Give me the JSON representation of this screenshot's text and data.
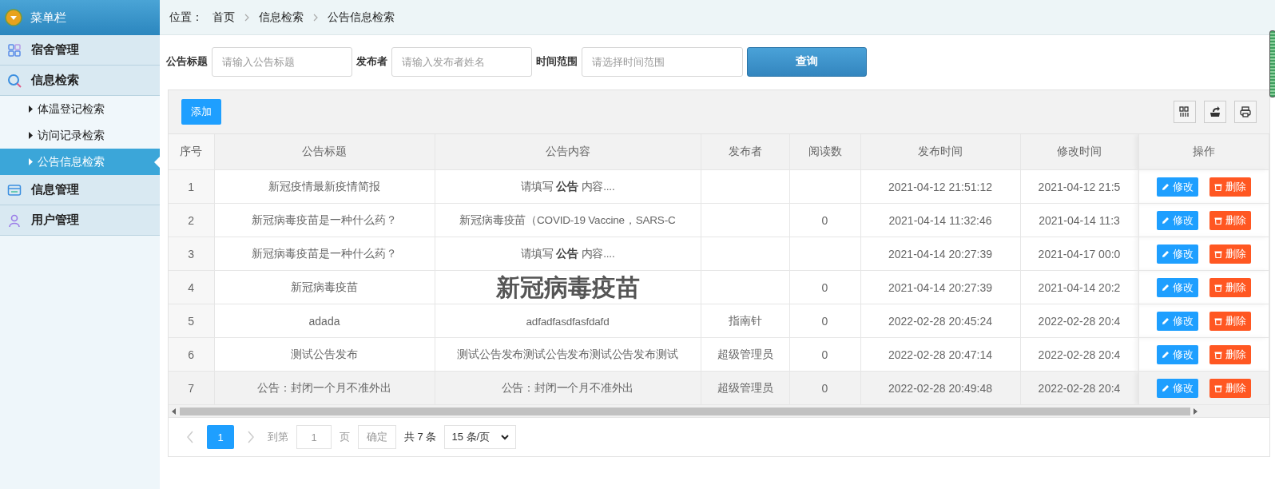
{
  "sidebar": {
    "title": "菜单栏",
    "items": [
      {
        "label": "宿舍管理"
      },
      {
        "label": "信息检索",
        "children": [
          {
            "label": "体温登记检索",
            "selected": false
          },
          {
            "label": "访问记录检索",
            "selected": false
          },
          {
            "label": "公告信息检索",
            "selected": true
          }
        ]
      },
      {
        "label": "信息管理"
      },
      {
        "label": "用户管理"
      }
    ]
  },
  "breadcrumb": {
    "label": "位置：",
    "path": [
      "首页",
      "信息检索",
      "公告信息检索"
    ]
  },
  "filters": [
    {
      "label": "公告标题",
      "placeholder": "请输入公告标题"
    },
    {
      "label": "发布者",
      "placeholder": "请输入发布者姓名"
    },
    {
      "label": "时间范围",
      "placeholder": "请选择时间范围"
    }
  ],
  "search_button": "查询",
  "add_button": "添加",
  "table": {
    "columns": [
      "序号",
      "公告标题",
      "公告内容",
      "发布者",
      "阅读数",
      "发布时间",
      "修改时间",
      "操作"
    ],
    "rows": [
      {
        "kind": "text",
        "no": "1",
        "title": "新冠疫情最新疫情简报",
        "content": "请填写 **公告** 内容....",
        "created": "2021-04-12 21:51:12",
        "modified": "2021-04-12 21:5",
        "actions": [
          "修改",
          "删除"
        ],
        "selected": false
      },
      {
        "kind": "text",
        "no": "2",
        "title": "新冠病毒疫苗是一种什么药？",
        "content": "新冠病毒疫苗（COVID-19 Vaccine，SARS-C",
        "reads": "0",
        "created": "2021-04-14 11:32:46",
        "modified": "2021-04-14 11:3",
        "actions": [
          "修改",
          "删除"
        ],
        "selected": false
      },
      {
        "kind": "text",
        "no": "3",
        "title": "新冠病毒疫苗是一种什么药？",
        "content": "请填写 **公告** 内容....",
        "created": "2021-04-14 20:27:39",
        "modified": "2021-04-17 00:0",
        "actions": [
          "修改",
          "删除"
        ],
        "selected": false
      },
      {
        "kind": "heading",
        "no": "4",
        "title": "新冠病毒疫苗",
        "content": "新冠病毒疫苗",
        "reads": "0",
        "created": "2021-04-14 20:27:39",
        "modified": "2021-04-14 20:2",
        "actions": [
          "修改",
          "删除"
        ],
        "selected": false
      },
      {
        "kind": "text",
        "no": "5",
        "title": "adada",
        "content": "adfadfasdfasfdafd",
        "publisher": "指南针",
        "reads": "0",
        "created": "2022-02-28 20:45:24",
        "modified": "2022-02-28 20:4",
        "actions": [
          "修改",
          "删除"
        ],
        "selected": false
      },
      {
        "kind": "text",
        "no": "6",
        "title": "测试公告发布",
        "content": "测试公告发布测试公告发布测试公告发布测试",
        "publisher": "超级管理员",
        "reads": "0",
        "created": "2022-02-28 20:47:14",
        "modified": "2022-02-28 20:4",
        "actions": [
          "修改",
          "删除"
        ],
        "selected": false
      },
      {
        "kind": "text",
        "no": "7",
        "title": "公告：封闭一个月不准外出",
        "content": "公告：封闭一个月不准外出",
        "publisher": "超级管理员",
        "reads": "0",
        "created": "2022-02-28 20:49:48",
        "modified": "2022-02-28 20:4",
        "actions": [
          "修改",
          "删除"
        ],
        "selected": true
      }
    ]
  },
  "pager": {
    "pages": [
      {
        "label": "1",
        "selected": true
      }
    ],
    "goto_label": "到第",
    "goto_value": "1",
    "page_unit": "页",
    "confirm": "确定",
    "total": "共 7 条",
    "page_size": "15 条/页"
  }
}
